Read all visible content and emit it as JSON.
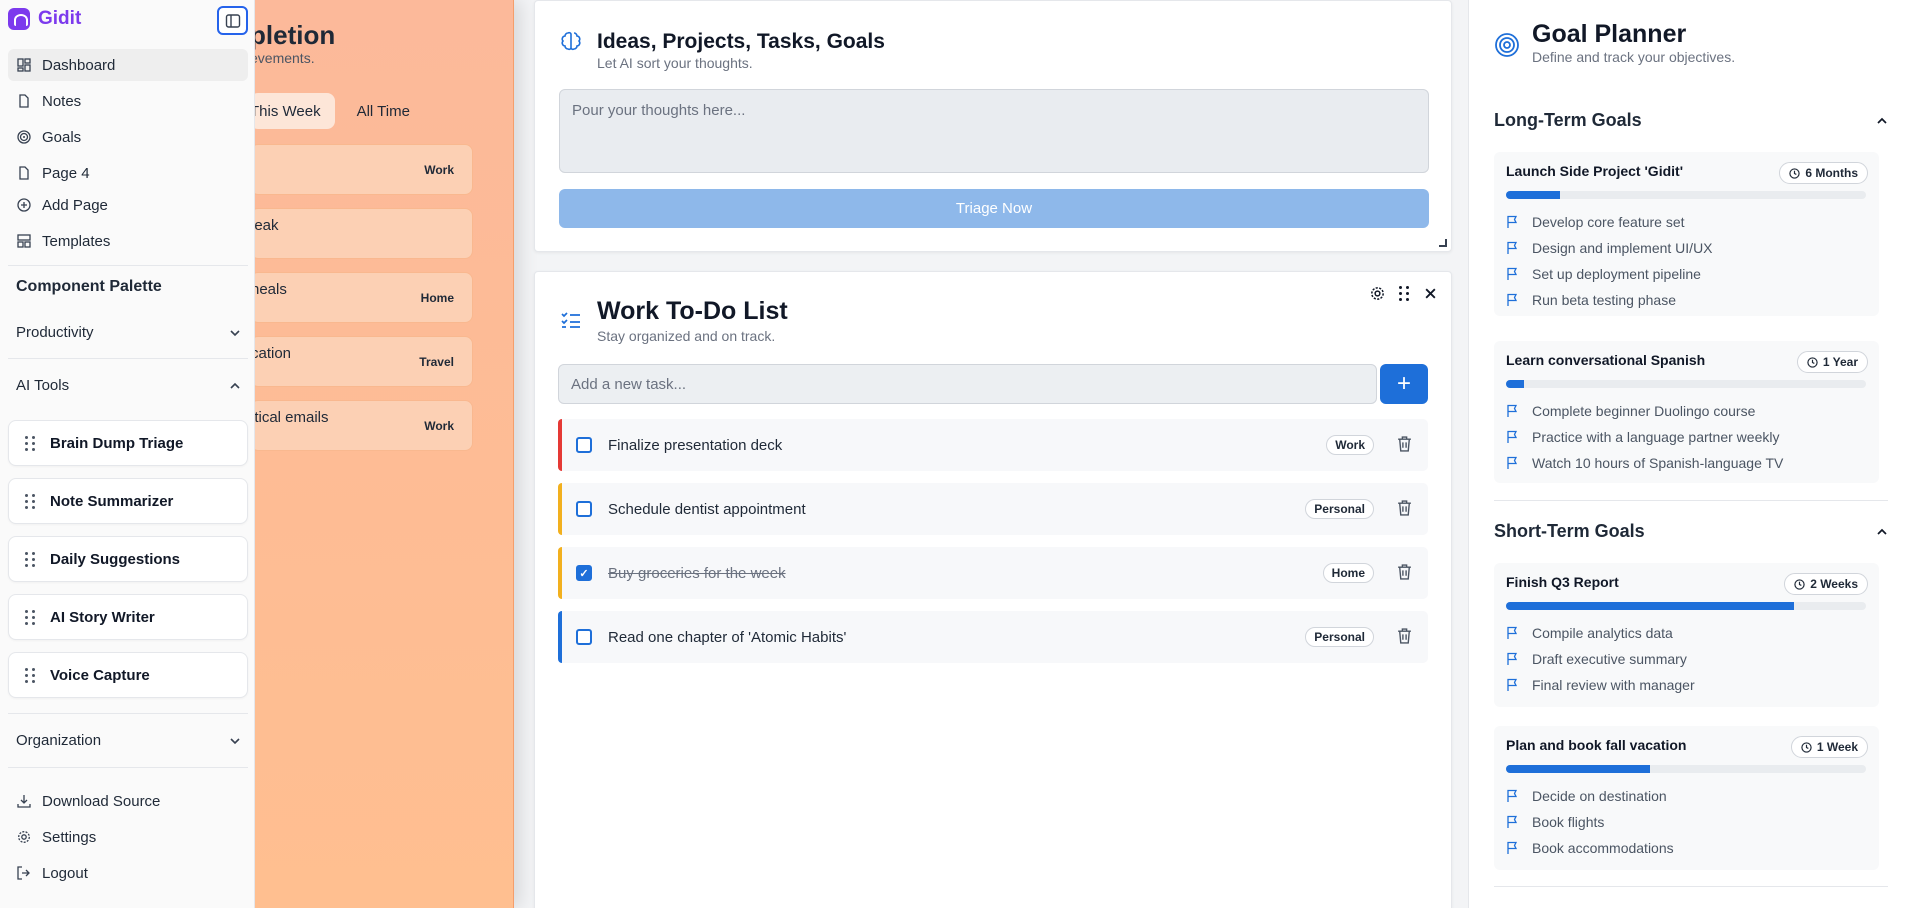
{
  "sidebar": {
    "brand": "Gidit",
    "nav": [
      {
        "label": "Dashboard",
        "icon": "dashboard-icon"
      },
      {
        "label": "Notes",
        "icon": "file-icon"
      },
      {
        "label": "Goals",
        "icon": "target-icon"
      },
      {
        "label": "Page 4",
        "icon": "file-icon"
      },
      {
        "label": "Add Page",
        "icon": "plus-circle-icon"
      },
      {
        "label": "Templates",
        "icon": "template-icon"
      }
    ],
    "palette_title": "Component Palette",
    "groups": {
      "productivity": "Productivity",
      "ai_tools": "AI Tools",
      "organization": "Organization"
    },
    "ai_tools": [
      "Brain Dump Triage",
      "Note Summarizer",
      "Daily Suggestions",
      "AI Story Writer",
      "Voice Capture"
    ],
    "footer": [
      "Download Source",
      "Settings",
      "Logout"
    ]
  },
  "completion": {
    "title": "pletion",
    "subtitle": "evements.",
    "tabs": [
      "This Week",
      "All Time"
    ],
    "items": [
      {
        "text": "",
        "tag": "Work"
      },
      {
        "text": "leak",
        "tag": ""
      },
      {
        "text": "neals",
        "tag": "Home"
      },
      {
        "text": "cation",
        "tag": "Travel"
      },
      {
        "text": "itical emails",
        "tag": "Work"
      }
    ]
  },
  "triage": {
    "title": "Ideas, Projects, Tasks, Goals",
    "subtitle": "Let AI sort your thoughts.",
    "placeholder": "Pour your thoughts here...",
    "button": "Triage Now"
  },
  "todo": {
    "title": "Work To-Do List",
    "subtitle": "Stay organized and on track.",
    "input_placeholder": "Add a new task...",
    "add_label": "+",
    "tasks": [
      {
        "text": "Finalize presentation deck",
        "tag": "Work",
        "done": false,
        "color": "#e53935"
      },
      {
        "text": "Schedule dentist appointment",
        "tag": "Personal",
        "done": false,
        "color": "#f2b01e"
      },
      {
        "text": "Buy groceries for the week",
        "tag": "Home",
        "done": true,
        "color": "#f2b01e"
      },
      {
        "text": "Read one chapter of 'Atomic Habits'",
        "tag": "Personal",
        "done": false,
        "color": "#1e6fd9"
      }
    ]
  },
  "planner": {
    "title": "Goal Planner",
    "subtitle": "Define and track your objectives.",
    "long_term_title": "Long-Term Goals",
    "short_term_title": "Short-Term Goals",
    "long_term": [
      {
        "title": "Launch Side Project 'Gidit'",
        "badge": "6 Months",
        "progress": 0.15,
        "steps": [
          "Develop core feature set",
          "Design and implement UI/UX",
          "Set up deployment pipeline",
          "Run beta testing phase"
        ]
      },
      {
        "title": "Learn conversational Spanish",
        "badge": "1 Year",
        "progress": 0.05,
        "steps": [
          "Complete beginner Duolingo course",
          "Practice with a language partner weekly",
          "Watch 10 hours of Spanish-language TV"
        ]
      }
    ],
    "short_term": [
      {
        "title": "Finish Q3 Report",
        "badge": "2 Weeks",
        "progress": 0.8,
        "steps": [
          "Compile analytics data",
          "Draft executive summary",
          "Final review with manager"
        ]
      },
      {
        "title": "Plan and book fall vacation",
        "badge": "1 Week",
        "progress": 0.4,
        "steps": [
          "Decide on destination",
          "Book flights",
          "Book accommodations"
        ]
      }
    ]
  },
  "colors": {
    "accent": "#1e6fd9",
    "brand": "#7c3aed",
    "completion_bg": "#fcb99a"
  }
}
